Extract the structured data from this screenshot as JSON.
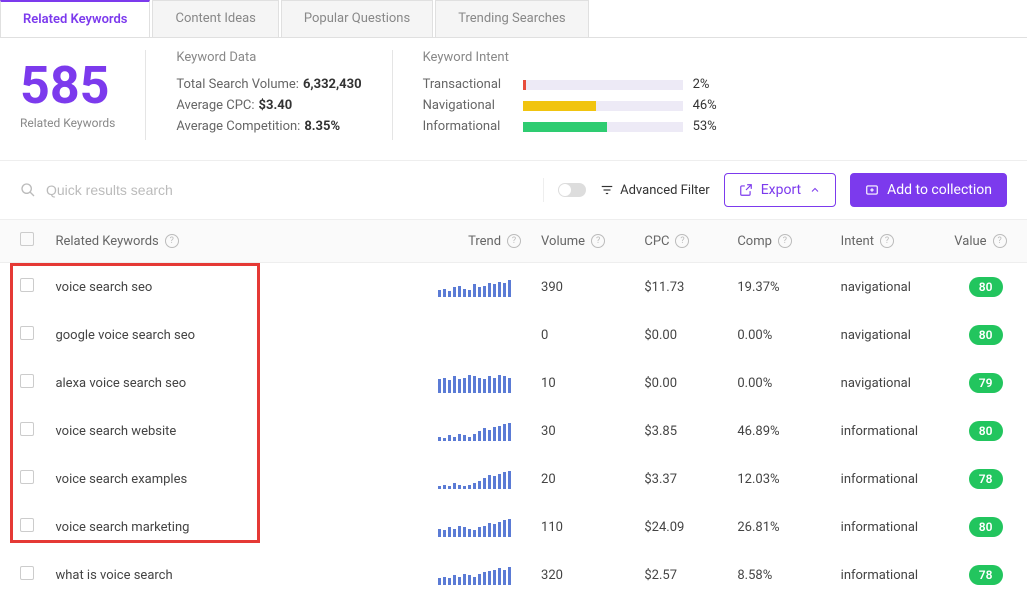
{
  "tabs": [
    {
      "label": "Related Keywords",
      "active": true
    },
    {
      "label": "Content Ideas",
      "active": false
    },
    {
      "label": "Popular Questions",
      "active": false
    },
    {
      "label": "Trending Searches",
      "active": false
    }
  ],
  "summary": {
    "count": "585",
    "count_label": "Related Keywords",
    "keyword_data_title": "Keyword Data",
    "total_volume_label": "Total Search Volume:",
    "total_volume": "6,332,430",
    "avg_cpc_label": "Average CPC:",
    "avg_cpc": "$3.40",
    "avg_comp_label": "Average Competition:",
    "avg_comp": "8.35%",
    "intent_title": "Keyword Intent",
    "intents": [
      {
        "label": "Transactional",
        "pct": "2%",
        "width": 2,
        "color": "#e74c3c"
      },
      {
        "label": "Navigational",
        "pct": "46%",
        "width": 46,
        "color": "#f1c40f"
      },
      {
        "label": "Informational",
        "pct": "53%",
        "width": 53,
        "color": "#2ecc71"
      }
    ]
  },
  "toolbar": {
    "search_placeholder": "Quick results search",
    "advanced_filter": "Advanced Filter",
    "export": "Export",
    "add_collection": "Add to collection"
  },
  "columns": {
    "keyword": "Related Keywords",
    "trend": "Trend",
    "volume": "Volume",
    "cpc": "CPC",
    "comp": "Comp",
    "intent": "Intent",
    "value": "Value"
  },
  "rows": [
    {
      "keyword": "voice search seo",
      "trend": [
        5,
        6,
        4,
        7,
        8,
        6,
        5,
        9,
        7,
        8,
        10,
        9,
        11,
        10,
        12
      ],
      "volume": "390",
      "cpc": "$11.73",
      "comp": "19.37%",
      "intent": "navigational",
      "value": "80"
    },
    {
      "keyword": "google voice search seo",
      "trend": [],
      "volume": "0",
      "cpc": "$0.00",
      "comp": "0.00%",
      "intent": "navigational",
      "value": "80"
    },
    {
      "keyword": "alexa voice search seo",
      "trend": [
        10,
        11,
        9,
        12,
        10,
        11,
        13,
        12,
        11,
        10,
        12,
        11,
        13,
        12,
        11
      ],
      "volume": "10",
      "cpc": "$0.00",
      "comp": "0.00%",
      "intent": "navigational",
      "value": "79"
    },
    {
      "keyword": "voice search website",
      "trend": [
        3,
        2,
        4,
        3,
        5,
        4,
        3,
        5,
        7,
        9,
        8,
        10,
        11,
        12,
        13
      ],
      "volume": "30",
      "cpc": "$3.85",
      "comp": "46.89%",
      "intent": "informational",
      "value": "80"
    },
    {
      "keyword": "voice search examples",
      "trend": [
        2,
        3,
        2,
        4,
        3,
        2,
        3,
        4,
        6,
        8,
        10,
        9,
        11,
        12,
        13
      ],
      "volume": "20",
      "cpc": "$3.37",
      "comp": "12.03%",
      "intent": "informational",
      "value": "78"
    },
    {
      "keyword": "voice search marketing",
      "trend": [
        6,
        5,
        7,
        6,
        8,
        7,
        6,
        5,
        7,
        8,
        10,
        9,
        11,
        12,
        13
      ],
      "volume": "110",
      "cpc": "$24.09",
      "comp": "26.81%",
      "intent": "informational",
      "value": "80"
    },
    {
      "keyword": "what is voice search",
      "trend": [
        5,
        6,
        5,
        7,
        6,
        8,
        7,
        6,
        8,
        9,
        10,
        11,
        12,
        11,
        13
      ],
      "volume": "320",
      "cpc": "$2.57",
      "comp": "8.58%",
      "intent": "informational",
      "value": "78"
    }
  ]
}
